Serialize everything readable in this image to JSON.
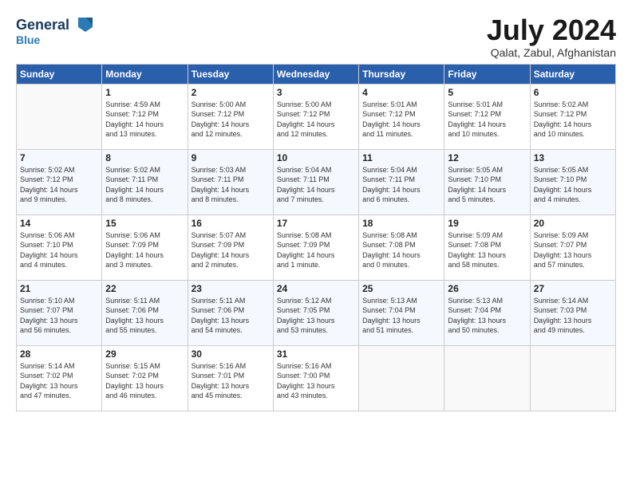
{
  "header": {
    "logo_line1": "General",
    "logo_line2": "Blue",
    "month": "July 2024",
    "location": "Qalat, Zabul, Afghanistan"
  },
  "weekdays": [
    "Sunday",
    "Monday",
    "Tuesday",
    "Wednesday",
    "Thursday",
    "Friday",
    "Saturday"
  ],
  "weeks": [
    [
      {
        "day": "",
        "info": ""
      },
      {
        "day": "1",
        "info": "Sunrise: 4:59 AM\nSunset: 7:12 PM\nDaylight: 14 hours\nand 13 minutes."
      },
      {
        "day": "2",
        "info": "Sunrise: 5:00 AM\nSunset: 7:12 PM\nDaylight: 14 hours\nand 12 minutes."
      },
      {
        "day": "3",
        "info": "Sunrise: 5:00 AM\nSunset: 7:12 PM\nDaylight: 14 hours\nand 12 minutes."
      },
      {
        "day": "4",
        "info": "Sunrise: 5:01 AM\nSunset: 7:12 PM\nDaylight: 14 hours\nand 11 minutes."
      },
      {
        "day": "5",
        "info": "Sunrise: 5:01 AM\nSunset: 7:12 PM\nDaylight: 14 hours\nand 10 minutes."
      },
      {
        "day": "6",
        "info": "Sunrise: 5:02 AM\nSunset: 7:12 PM\nDaylight: 14 hours\nand 10 minutes."
      }
    ],
    [
      {
        "day": "7",
        "info": "Sunrise: 5:02 AM\nSunset: 7:12 PM\nDaylight: 14 hours\nand 9 minutes."
      },
      {
        "day": "8",
        "info": "Sunrise: 5:02 AM\nSunset: 7:11 PM\nDaylight: 14 hours\nand 8 minutes."
      },
      {
        "day": "9",
        "info": "Sunrise: 5:03 AM\nSunset: 7:11 PM\nDaylight: 14 hours\nand 8 minutes."
      },
      {
        "day": "10",
        "info": "Sunrise: 5:04 AM\nSunset: 7:11 PM\nDaylight: 14 hours\nand 7 minutes."
      },
      {
        "day": "11",
        "info": "Sunrise: 5:04 AM\nSunset: 7:11 PM\nDaylight: 14 hours\nand 6 minutes."
      },
      {
        "day": "12",
        "info": "Sunrise: 5:05 AM\nSunset: 7:10 PM\nDaylight: 14 hours\nand 5 minutes."
      },
      {
        "day": "13",
        "info": "Sunrise: 5:05 AM\nSunset: 7:10 PM\nDaylight: 14 hours\nand 4 minutes."
      }
    ],
    [
      {
        "day": "14",
        "info": "Sunrise: 5:06 AM\nSunset: 7:10 PM\nDaylight: 14 hours\nand 4 minutes."
      },
      {
        "day": "15",
        "info": "Sunrise: 5:06 AM\nSunset: 7:09 PM\nDaylight: 14 hours\nand 3 minutes."
      },
      {
        "day": "16",
        "info": "Sunrise: 5:07 AM\nSunset: 7:09 PM\nDaylight: 14 hours\nand 2 minutes."
      },
      {
        "day": "17",
        "info": "Sunrise: 5:08 AM\nSunset: 7:09 PM\nDaylight: 14 hours\nand 1 minute."
      },
      {
        "day": "18",
        "info": "Sunrise: 5:08 AM\nSunset: 7:08 PM\nDaylight: 14 hours\nand 0 minutes."
      },
      {
        "day": "19",
        "info": "Sunrise: 5:09 AM\nSunset: 7:08 PM\nDaylight: 13 hours\nand 58 minutes."
      },
      {
        "day": "20",
        "info": "Sunrise: 5:09 AM\nSunset: 7:07 PM\nDaylight: 13 hours\nand 57 minutes."
      }
    ],
    [
      {
        "day": "21",
        "info": "Sunrise: 5:10 AM\nSunset: 7:07 PM\nDaylight: 13 hours\nand 56 minutes."
      },
      {
        "day": "22",
        "info": "Sunrise: 5:11 AM\nSunset: 7:06 PM\nDaylight: 13 hours\nand 55 minutes."
      },
      {
        "day": "23",
        "info": "Sunrise: 5:11 AM\nSunset: 7:06 PM\nDaylight: 13 hours\nand 54 minutes."
      },
      {
        "day": "24",
        "info": "Sunrise: 5:12 AM\nSunset: 7:05 PM\nDaylight: 13 hours\nand 53 minutes."
      },
      {
        "day": "25",
        "info": "Sunrise: 5:13 AM\nSunset: 7:04 PM\nDaylight: 13 hours\nand 51 minutes."
      },
      {
        "day": "26",
        "info": "Sunrise: 5:13 AM\nSunset: 7:04 PM\nDaylight: 13 hours\nand 50 minutes."
      },
      {
        "day": "27",
        "info": "Sunrise: 5:14 AM\nSunset: 7:03 PM\nDaylight: 13 hours\nand 49 minutes."
      }
    ],
    [
      {
        "day": "28",
        "info": "Sunrise: 5:14 AM\nSunset: 7:02 PM\nDaylight: 13 hours\nand 47 minutes."
      },
      {
        "day": "29",
        "info": "Sunrise: 5:15 AM\nSunset: 7:02 PM\nDaylight: 13 hours\nand 46 minutes."
      },
      {
        "day": "30",
        "info": "Sunrise: 5:16 AM\nSunset: 7:01 PM\nDaylight: 13 hours\nand 45 minutes."
      },
      {
        "day": "31",
        "info": "Sunrise: 5:16 AM\nSunset: 7:00 PM\nDaylight: 13 hours\nand 43 minutes."
      },
      {
        "day": "",
        "info": ""
      },
      {
        "day": "",
        "info": ""
      },
      {
        "day": "",
        "info": ""
      }
    ]
  ]
}
